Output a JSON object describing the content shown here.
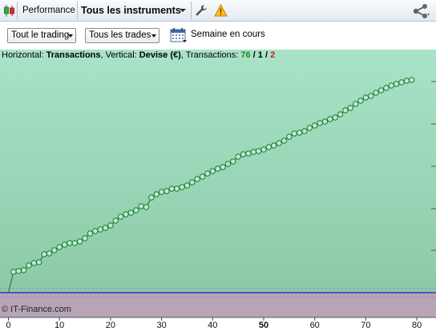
{
  "toolbar": {
    "performance_label": "Performance",
    "instruments_label": "Tous les instruments",
    "icons": [
      "candlestick-icon",
      "wrench-icon",
      "warning-icon",
      "share-icon"
    ]
  },
  "filters": {
    "trading_value": "Tout le trading",
    "trades_value": "Tous les trades",
    "period_label": "Semaine en cours"
  },
  "chart_info": {
    "horizontal_prefix": "Horizontal: ",
    "horizontal_value": "Transactions",
    "vertical_prefix": ", Vertical: ",
    "vertical_value": "Devise (€)",
    "transactions_prefix": ", Transactions: ",
    "count_winning": "76",
    "sep1": " / ",
    "count_neutral": "1",
    "sep2": " / ",
    "count_losing": "2"
  },
  "copyright": "© IT-Finance.com",
  "colors": {
    "upper_area_top": "#a9e3c8",
    "upper_area_bottom": "#8dc9a8",
    "lower_area": "#b7a5b5",
    "line": "#1c7a2c",
    "zero_line": "#2336c8"
  },
  "chart_data": {
    "type": "line",
    "xlabel": "",
    "ylabel": "",
    "xlim": [
      -2,
      84
    ],
    "x_ticks": [
      "0",
      "10",
      "20",
      "30",
      "40",
      "50",
      "60",
      "70",
      "80"
    ],
    "x_ticks_bold": [
      "50"
    ],
    "series": [
      {
        "values": [
          0,
          26,
          27,
          28,
          34,
          37,
          38,
          48,
          49,
          53,
          57,
          60,
          62,
          62,
          64,
          68,
          74,
          77,
          79,
          81,
          84,
          90,
          95,
          98,
          100,
          103,
          108,
          107,
          119,
          123,
          126,
          127,
          130,
          130,
          132,
          134,
          138,
          142,
          145,
          149,
          152,
          155,
          157,
          161,
          164,
          170,
          173,
          174,
          176,
          177,
          179,
          182,
          184,
          187,
          190,
          195,
          199,
          200,
          202,
          206,
          209,
          212,
          214,
          217,
          219,
          223,
          228,
          231,
          236,
          240,
          244,
          246,
          250,
          253,
          256,
          259,
          261,
          263,
          265,
          266
        ]
      }
    ]
  }
}
